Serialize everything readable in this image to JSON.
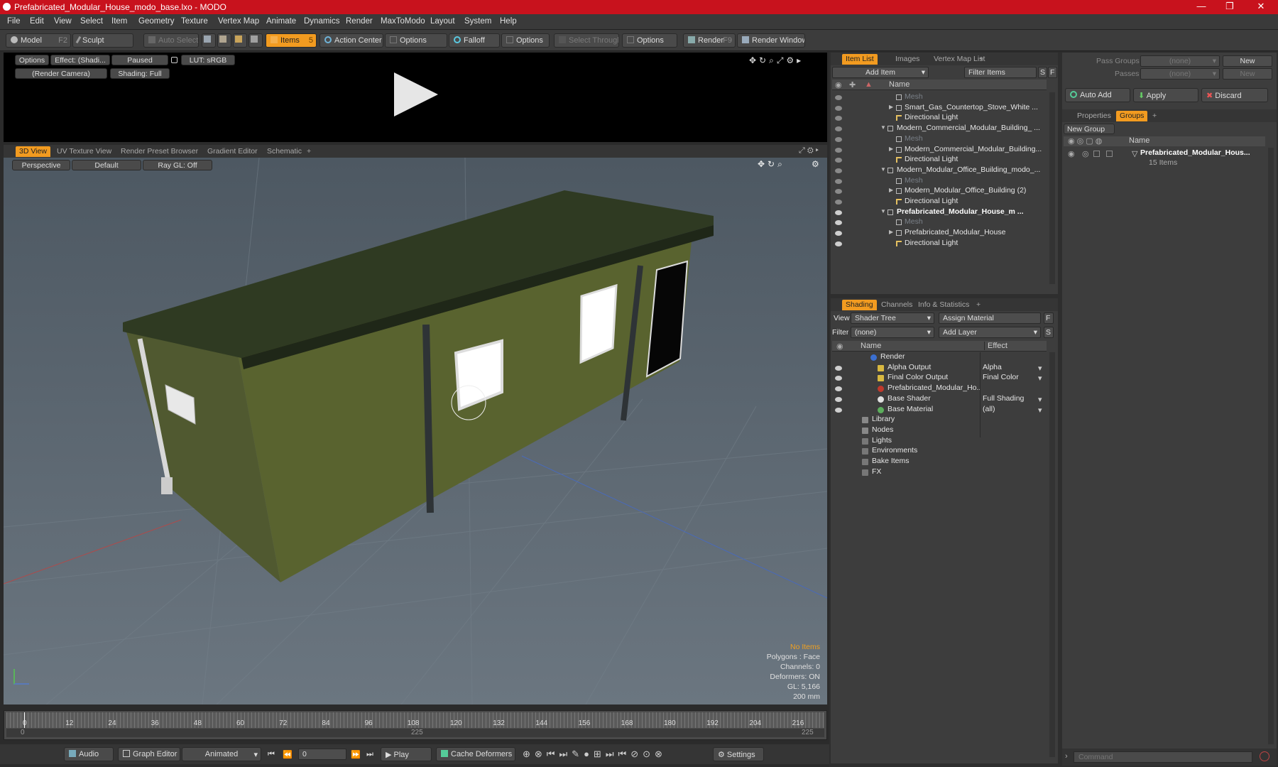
{
  "window": {
    "title": "Prefabricated_Modular_House_modo_base.lxo - MODO"
  },
  "menu": [
    "File",
    "Edit",
    "View",
    "Select",
    "Item",
    "Geometry",
    "Texture",
    "Vertex Map",
    "Animate",
    "Dynamics",
    "Render",
    "MaxToModo",
    "Layout",
    "System",
    "Help"
  ],
  "toolbar": {
    "model": "Model",
    "model_key": "F2",
    "sculpt": "Sculpt",
    "auto_select": "Auto Select",
    "items": "Items",
    "items_key": "5",
    "action_center": "Action Center",
    "options1": "Options",
    "falloff": "Falloff",
    "options2": "Options",
    "select_through": "Select Through",
    "options3": "Options",
    "render": "Render",
    "render_key": "F9",
    "render_window": "Render Window"
  },
  "preview": {
    "options": "Options",
    "effect": "Effect: (Shadi...",
    "paused": "Paused",
    "lut": "LUT: sRGB",
    "camera": "(Render Camera)",
    "shading": "Shading: Full"
  },
  "viewport": {
    "tabs": [
      "3D View",
      "UV Texture View",
      "Render Preset Browser",
      "Gradient Editor",
      "Schematic",
      "+"
    ],
    "perspective": "Perspective",
    "default": "Default",
    "raygl": "Ray GL: Off",
    "hud": {
      "no_items": "No Items",
      "polygons": "Polygons : Face",
      "channels": "Channels: 0",
      "deformers": "Deformers: ON",
      "gl": "GL: 5,166",
      "size": "200 mm"
    }
  },
  "timeline": {
    "ticks": [
      "0",
      "12",
      "24",
      "36",
      "48",
      "60",
      "72",
      "84",
      "96",
      "108",
      "120",
      "132",
      "144",
      "156",
      "168",
      "180",
      "192",
      "204",
      "216"
    ],
    "start": "0",
    "mid": "225",
    "end": "225"
  },
  "transport": {
    "audio": "Audio",
    "graph_editor": "Graph Editor",
    "animated": "Animated",
    "frame": "0",
    "play": "Play",
    "cache": "Cache Deformers",
    "settings": "Settings"
  },
  "item_list": {
    "tabs": [
      "Item List",
      "Images",
      "Vertex Map List",
      "+"
    ],
    "add_item": "Add Item",
    "filter": "Filter Items",
    "s": "S",
    "f": "F",
    "col_name": "Name",
    "rows": [
      {
        "text": "Mesh",
        "style": "dim"
      },
      {
        "text": "Smart_Gas_Countertop_Stove_White ...",
        "style": ""
      },
      {
        "text": "Directional Light",
        "style": ""
      },
      {
        "text": "Modern_Commercial_Modular_Building_ ...",
        "style": ""
      },
      {
        "text": "Mesh",
        "style": "dim"
      },
      {
        "text": "Modern_Commercial_Modular_Building...",
        "style": ""
      },
      {
        "text": "Directional Light",
        "style": ""
      },
      {
        "text": "Modern_Modular_Office_Building_modo_...",
        "style": ""
      },
      {
        "text": "Mesh",
        "style": "dim"
      },
      {
        "text": "Modern_Modular_Office_Building (2)",
        "style": ""
      },
      {
        "text": "Directional Light",
        "style": ""
      },
      {
        "text": "Prefabricated_Modular_House_m ...",
        "style": "bold"
      },
      {
        "text": "Mesh",
        "style": "dim"
      },
      {
        "text": "Prefabricated_Modular_House",
        "style": ""
      },
      {
        "text": "Directional Light",
        "style": ""
      }
    ]
  },
  "shading": {
    "tabs": [
      "Shading",
      "Channels",
      "Info & Statistics",
      "+"
    ],
    "view_label": "View",
    "view_value": "Shader Tree",
    "assign": "Assign Material",
    "filter_label": "Filter",
    "filter_value": "(none)",
    "add_layer": "Add Layer",
    "f": "F",
    "s": "S",
    "col_name": "Name",
    "col_effect": "Effect",
    "rows": [
      {
        "name": "Render",
        "effect": ""
      },
      {
        "name": "Alpha Output",
        "effect": "Alpha"
      },
      {
        "name": "Final Color Output",
        "effect": "Final Color"
      },
      {
        "name": "Prefabricated_Modular_Ho...",
        "effect": ""
      },
      {
        "name": "Base Shader",
        "effect": "Full Shading"
      },
      {
        "name": "Base Material",
        "effect": "(all)"
      },
      {
        "name": "Library",
        "effect": ""
      },
      {
        "name": "Nodes",
        "effect": ""
      },
      {
        "name": "Lights",
        "effect": ""
      },
      {
        "name": "Environments",
        "effect": ""
      },
      {
        "name": "Bake Items",
        "effect": ""
      },
      {
        "name": "FX",
        "effect": ""
      }
    ]
  },
  "groups": {
    "pass_groups_label": "Pass Groups",
    "pass_groups_value": "(none)",
    "new": "New",
    "passes_label": "Passes",
    "passes_value": "(none)",
    "new2": "New",
    "auto_add": "Auto Add",
    "apply": "Apply",
    "discard": "Discard",
    "tabs": [
      "Properties",
      "Groups",
      "+"
    ],
    "new_group": "New Group",
    "col_name": "Name",
    "group_name": "Prefabricated_Modular_Hous...",
    "group_count": "15 Items"
  },
  "command": {
    "placeholder": "Command"
  }
}
